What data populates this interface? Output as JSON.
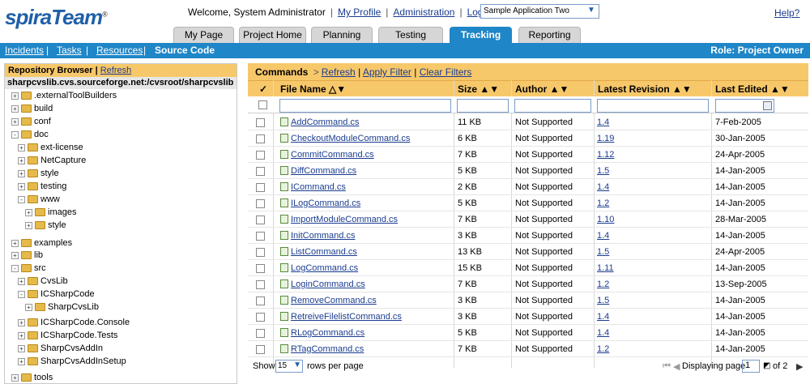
{
  "header": {
    "logo_text": "spiraTeam",
    "logo_reg": "®",
    "welcome": "Welcome, System Administrator",
    "links": [
      "My Profile",
      "Administration",
      "Log Out"
    ],
    "project_select": "Sample Application Two",
    "help": "Help?"
  },
  "tabs": [
    {
      "label": "My Page"
    },
    {
      "label": "Project Home"
    },
    {
      "label": "Planning"
    },
    {
      "label": "Testing"
    },
    {
      "label": "Tracking",
      "active": true
    },
    {
      "label": "Reporting"
    }
  ],
  "subnav": {
    "items": [
      "Incidents",
      "Tasks",
      "Resources",
      "Source Code"
    ],
    "role": "Role: Project Owner"
  },
  "repo": {
    "title": "Repository Browser",
    "refresh": "Refresh",
    "path": "sharpcvslib.cvs.sourceforge.net:/cvsroot/sharpcvslib",
    "tree": [
      {
        "label": ".externalToolBuilders",
        "level": 0,
        "exp": "+"
      },
      {
        "label": "build",
        "level": 0,
        "exp": "+"
      },
      {
        "label": "conf",
        "level": 0,
        "exp": "+"
      },
      {
        "label": "doc",
        "level": 0,
        "exp": "-"
      },
      {
        "label": "ext-license",
        "level": 1,
        "exp": "+"
      },
      {
        "label": "NetCapture",
        "level": 1,
        "exp": "+"
      },
      {
        "label": "style",
        "level": 1,
        "exp": "+"
      },
      {
        "label": "testing",
        "level": 1,
        "exp": "+"
      },
      {
        "label": "www",
        "level": 1,
        "exp": "-"
      },
      {
        "label": "images",
        "level": 2,
        "exp": "+"
      },
      {
        "label": "style",
        "level": 2,
        "exp": "+"
      },
      {
        "label": "examples",
        "level": 0,
        "exp": "+"
      },
      {
        "label": "lib",
        "level": 0,
        "exp": "+"
      },
      {
        "label": "src",
        "level": 0,
        "exp": "-"
      },
      {
        "label": "CvsLib",
        "level": 1,
        "exp": "+"
      },
      {
        "label": "ICSharpCode",
        "level": 1,
        "exp": "-"
      },
      {
        "label": "SharpCvsLib",
        "level": 2,
        "exp": "+"
      },
      {
        "label": "ICSharpCode.Console",
        "level": 1,
        "exp": "+"
      },
      {
        "label": "ICSharpCode.Tests",
        "level": 1,
        "exp": "+"
      },
      {
        "label": "SharpCvsAddIn",
        "level": 1,
        "exp": "+"
      },
      {
        "label": "SharpCvsAddInSetup",
        "level": 1,
        "exp": "+"
      },
      {
        "label": "tools",
        "level": 0,
        "exp": "+"
      }
    ]
  },
  "commands": {
    "label": "Commands",
    "arrow": ">",
    "links": [
      "Refresh",
      "Apply Filter",
      "Clear Filters"
    ]
  },
  "table": {
    "check_header": "✓",
    "columns": [
      "File Name △▼",
      "Size ▲▼",
      "Author ▲▼",
      "Latest Revision ▲▼",
      "Last Edited ▲▼"
    ],
    "rows": [
      {
        "name": "AddCommand.cs",
        "size": "11 KB",
        "author": "Not Supported",
        "rev": "1.4",
        "date": "7-Feb-2005"
      },
      {
        "name": "CheckoutModuleCommand.cs",
        "size": "6 KB",
        "author": "Not Supported",
        "rev": "1.19",
        "date": "30-Jan-2005"
      },
      {
        "name": "CommitCommand.cs",
        "size": "7 KB",
        "author": "Not Supported",
        "rev": "1.12",
        "date": "24-Apr-2005"
      },
      {
        "name": "DiffCommand.cs",
        "size": "5 KB",
        "author": "Not Supported",
        "rev": "1.5",
        "date": "14-Jan-2005"
      },
      {
        "name": "ICommand.cs",
        "size": "2 KB",
        "author": "Not Supported",
        "rev": "1.4",
        "date": "14-Jan-2005"
      },
      {
        "name": "ILogCommand.cs",
        "size": "5 KB",
        "author": "Not Supported",
        "rev": "1.2",
        "date": "14-Jan-2005"
      },
      {
        "name": "ImportModuleCommand.cs",
        "size": "7 KB",
        "author": "Not Supported",
        "rev": "1.10",
        "date": "28-Mar-2005"
      },
      {
        "name": "InitCommand.cs",
        "size": "3 KB",
        "author": "Not Supported",
        "rev": "1.4",
        "date": "14-Jan-2005"
      },
      {
        "name": "ListCommand.cs",
        "size": "13 KB",
        "author": "Not Supported",
        "rev": "1.5",
        "date": "24-Apr-2005"
      },
      {
        "name": "LogCommand.cs",
        "size": "15 KB",
        "author": "Not Supported",
        "rev": "1.11",
        "date": "14-Jan-2005"
      },
      {
        "name": "LoginCommand.cs",
        "size": "7 KB",
        "author": "Not Supported",
        "rev": "1.2",
        "date": "13-Sep-2005"
      },
      {
        "name": "RemoveCommand.cs",
        "size": "3 KB",
        "author": "Not Supported",
        "rev": "1.5",
        "date": "14-Jan-2005"
      },
      {
        "name": "RetreiveFilelistCommand.cs",
        "size": "3 KB",
        "author": "Not Supported",
        "rev": "1.4",
        "date": "14-Jan-2005"
      },
      {
        "name": "RLogCommand.cs",
        "size": "5 KB",
        "author": "Not Supported",
        "rev": "1.4",
        "date": "14-Jan-2005"
      },
      {
        "name": "RTagCommand.cs",
        "size": "7 KB",
        "author": "Not Supported",
        "rev": "1.2",
        "date": "14-Jan-2005"
      }
    ]
  },
  "footer": {
    "show": "Show",
    "page_size": "15",
    "rows_per_page": "rows per page",
    "displaying_page": "Displaying page",
    "page": "1",
    "of": "of 2"
  },
  "colors": {
    "accent": "#1f86c8",
    "header_orange": "#f7c86a",
    "link": "#1a3c8f"
  }
}
